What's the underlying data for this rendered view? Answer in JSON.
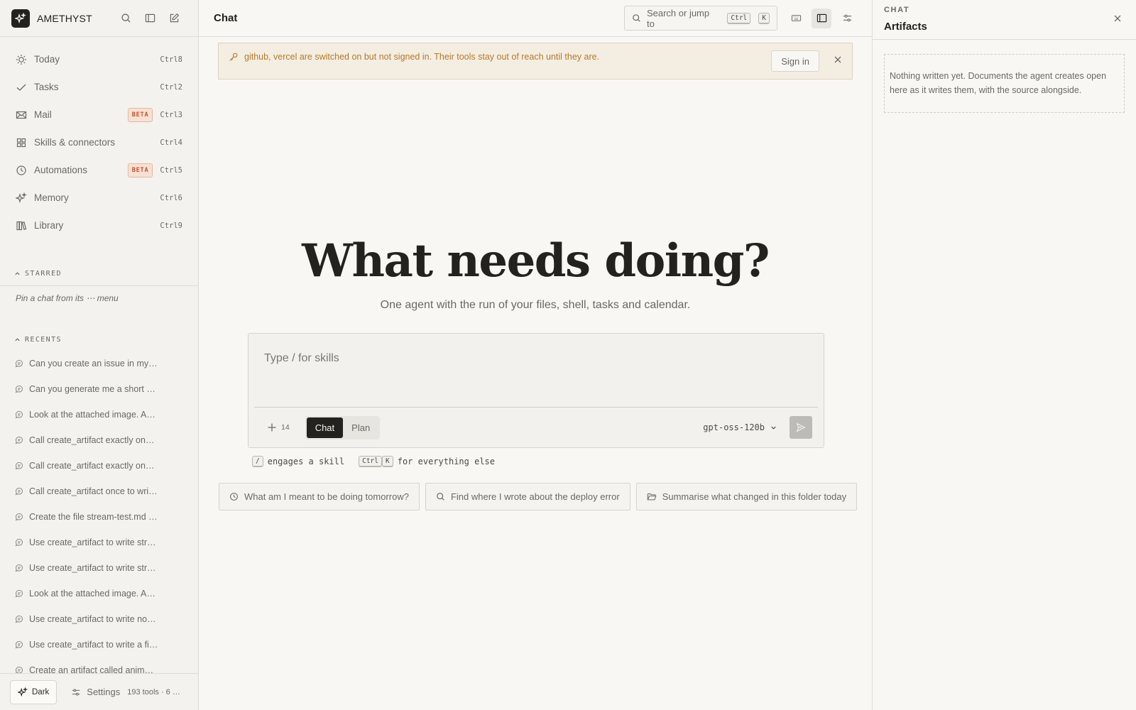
{
  "brand": {
    "name": "AMETHYST"
  },
  "nav": [
    {
      "label": "Today",
      "shortcut": "Ctrl8",
      "icon": "sun-icon"
    },
    {
      "label": "Tasks",
      "shortcut": "Ctrl2",
      "icon": "check-icon"
    },
    {
      "label": "Mail",
      "shortcut": "Ctrl3",
      "badge": "BETA",
      "icon": "mail-icon"
    },
    {
      "label": "Skills & connectors",
      "shortcut": "Ctrl4",
      "icon": "grid-icon"
    },
    {
      "label": "Automations",
      "shortcut": "Ctrl5",
      "badge": "BETA",
      "icon": "clock-icon"
    },
    {
      "label": "Memory",
      "shortcut": "Ctrl6",
      "icon": "sparkle-icon"
    },
    {
      "label": "Library",
      "shortcut": "Ctrl9",
      "icon": "books-icon"
    }
  ],
  "starred": {
    "heading": "STARRED",
    "hint": "Pin a chat from its ⋯ menu"
  },
  "recents": {
    "heading": "RECENTS",
    "items": [
      "Can you create an issue in my…",
      "Can you generate me a short …",
      "Look at the attached image. A…",
      "Call create_artifact exactly on…",
      "Call create_artifact exactly on…",
      "Call create_artifact once to wri…",
      "Create the file stream-test.md …",
      "Use create_artifact to write str…",
      "Use create_artifact to write str…",
      "Look at the attached image. A…",
      "Use create_artifact to write no…",
      "Use create_artifact to write a fi…",
      "Create an artifact called anim…"
    ]
  },
  "footer": {
    "dark_label": "Dark",
    "settings_label": "Settings",
    "settings_meta": "193 tools · 6 …"
  },
  "topbar": {
    "title": "Chat",
    "search_placeholder": "Search or jump to",
    "search_kbd1": "Ctrl",
    "search_kbd2": "K"
  },
  "banner": {
    "text": "github, vercel are switched on but not signed in. Their tools stay out of reach until they are.",
    "signin_label": "Sign in"
  },
  "hero": {
    "title": "What needs doing?",
    "subtitle": "One agent with the run of your files, shell, tasks and calendar."
  },
  "composer": {
    "placeholder": "Type / for skills",
    "attach_count": "14",
    "modes": [
      "Chat",
      "Plan"
    ],
    "active_mode": "Chat",
    "model": "gpt-oss-120b"
  },
  "hint": {
    "slash_key": "/",
    "slash_text": "engages a skill",
    "kbd1": "Ctrl",
    "kbd2": "K",
    "else_text": "for everything else"
  },
  "suggestions": [
    {
      "label": "What am I meant to be doing tomorrow?",
      "icon": "clock-icon"
    },
    {
      "label": "Find where I wrote about the deploy error",
      "icon": "search-icon"
    },
    {
      "label": "Summarise what changed in this folder today",
      "icon": "folder-icon"
    }
  ],
  "rpanel": {
    "kicker": "CHAT",
    "title": "Artifacts",
    "empty_text": "Nothing written yet. Documents the agent creates open here as it writes them, with the source alongside."
  },
  "colors": {
    "accent_dark": "#23221f",
    "beta_text": "#c2542a",
    "banner_text": "#b57a2c",
    "banner_bg": "#f4ede2"
  }
}
